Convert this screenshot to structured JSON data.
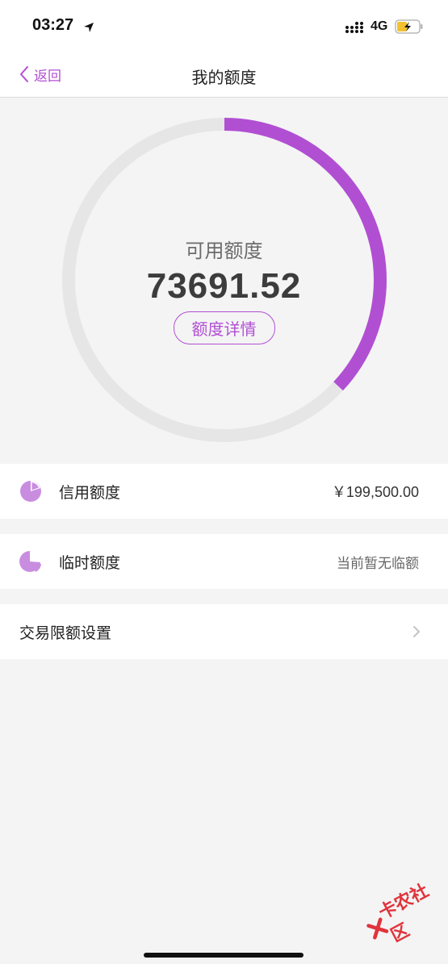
{
  "status_bar": {
    "time": "03:27",
    "network": "4G"
  },
  "nav": {
    "back_label": "返回",
    "title": "我的额度"
  },
  "limit": {
    "available_label": "可用额度",
    "available_amount": "73691.52",
    "details_button": "额度详情",
    "used_fraction": 0.3694
  },
  "rows": {
    "credit": {
      "label": "信用额度",
      "value": "￥199,500.00"
    },
    "temp": {
      "label": "临时额度",
      "value": "当前暂无临额"
    },
    "transaction": {
      "label": "交易限额设置"
    }
  },
  "watermark": {
    "text": "卡农社区"
  },
  "colors": {
    "accent": "#b14fd3",
    "ring_track": "#e6e6e6",
    "icon_fill": "#c98de0"
  },
  "icons": [
    "location-arrow-icon",
    "signal-icon",
    "battery-icon",
    "chevron-left-icon",
    "pie-chart-icon",
    "chevron-right-icon"
  ]
}
